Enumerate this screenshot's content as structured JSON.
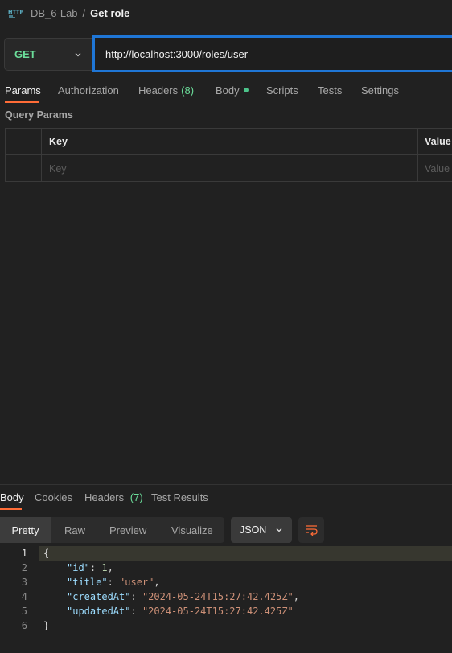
{
  "breadcrumb": {
    "icon": "http-request-icon",
    "collection": "DB_6-Lab",
    "separator": "/",
    "title": "Get role"
  },
  "request": {
    "method": "GET",
    "url": "http://localhost:3000/roles/user"
  },
  "request_tabs": [
    {
      "label": "Params",
      "active": true
    },
    {
      "label": "Authorization"
    },
    {
      "label": "Headers",
      "count": "(8)"
    },
    {
      "label": "Body",
      "indicator": "dot"
    },
    {
      "label": "Scripts"
    },
    {
      "label": "Tests"
    },
    {
      "label": "Settings"
    }
  ],
  "query_params": {
    "title": "Query Params",
    "columns": [
      "Key",
      "Value"
    ],
    "placeholder_key": "Key",
    "placeholder_value": "Value"
  },
  "response_tabs": [
    {
      "label": "Body",
      "active": true
    },
    {
      "label": "Cookies"
    },
    {
      "label": "Headers",
      "count": "(7)"
    },
    {
      "label": "Test Results"
    }
  ],
  "view_modes": [
    "Pretty",
    "Raw",
    "Preview",
    "Visualize"
  ],
  "active_view": "Pretty",
  "format": "JSON",
  "response_body": {
    "line_numbers": [
      "1",
      "2",
      "3",
      "4",
      "5",
      "6"
    ],
    "open_brace": "{",
    "close_brace": "}",
    "fields": [
      {
        "key": "\"id\"",
        "value": "1",
        "type": "number",
        "trail": ","
      },
      {
        "key": "\"title\"",
        "value": "\"user\"",
        "type": "string",
        "trail": ","
      },
      {
        "key": "\"createdAt\"",
        "value": "\"2024-05-24T15:27:42.425Z\"",
        "type": "string",
        "trail": ","
      },
      {
        "key": "\"updatedAt\"",
        "value": "\"2024-05-24T15:27:42.425Z\"",
        "type": "string",
        "trail": ""
      }
    ]
  },
  "colors": {
    "accent": "#ff6c37",
    "method_get": "#6bdd9a",
    "url_focus": "#1f76d6"
  }
}
